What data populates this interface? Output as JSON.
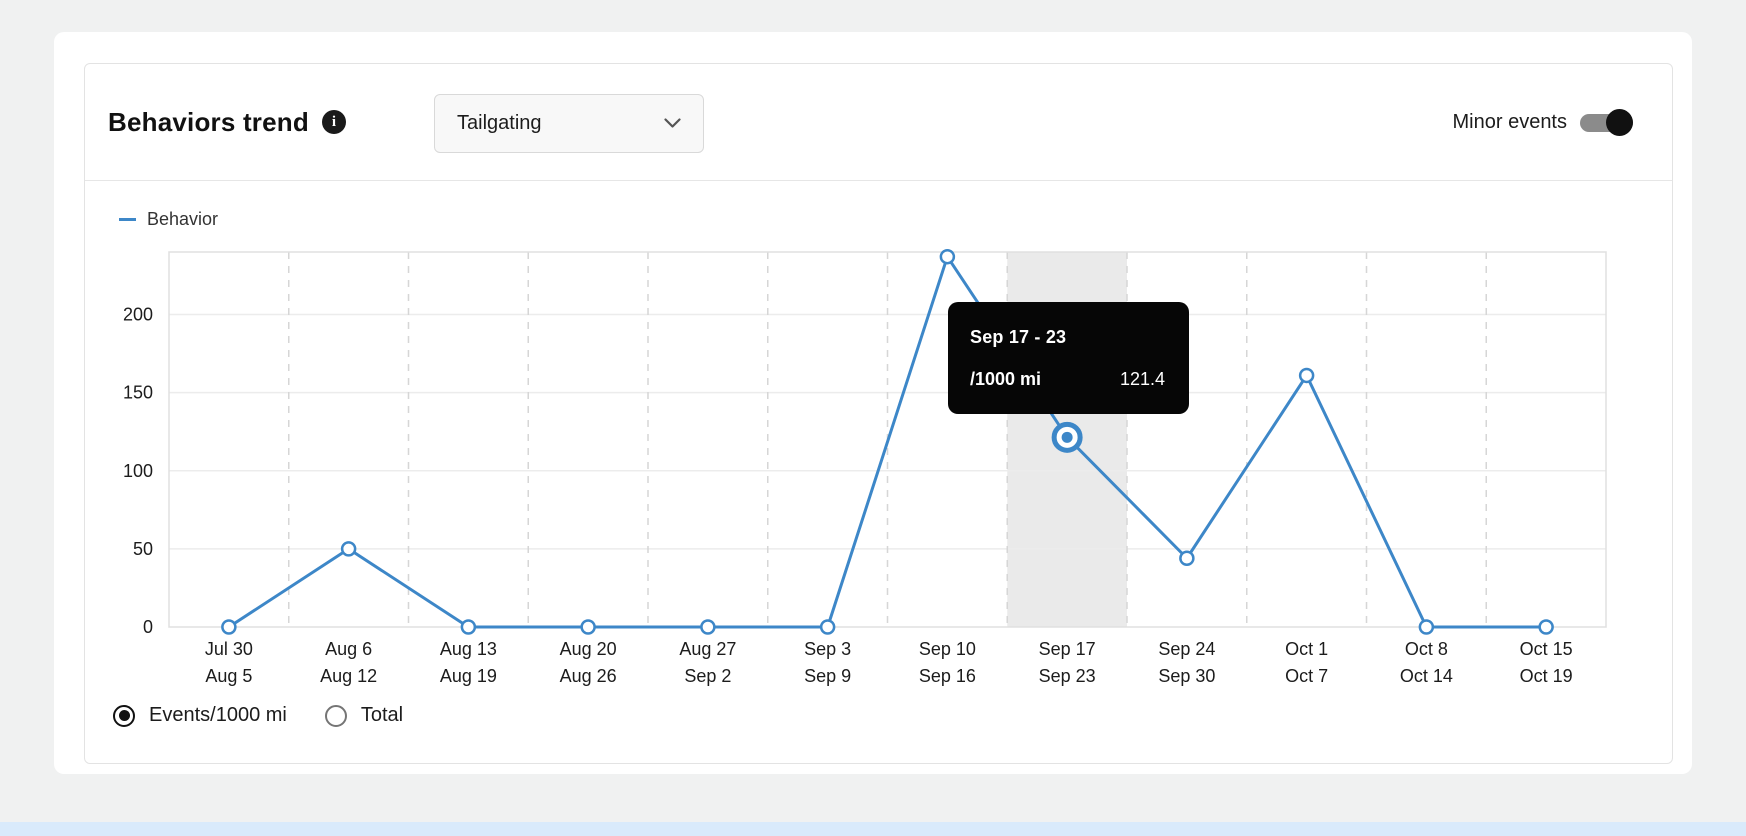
{
  "header": {
    "title": "Behaviors trend",
    "dropdown": {
      "value": "Tailgating"
    },
    "minor_events": {
      "label": "Minor events",
      "enabled": true
    }
  },
  "legend": {
    "items": [
      {
        "label": "Behavior",
        "color": "#3d87c8"
      }
    ]
  },
  "tooltip": {
    "title": "Sep 17 - 23",
    "label": "/1000 mi",
    "value": "121.4"
  },
  "controls": {
    "radios": [
      {
        "label": "Events/1000 mi",
        "selected": true
      },
      {
        "label": "Total",
        "selected": false
      }
    ]
  },
  "colors": {
    "accent_blue": "#3d87c8",
    "tooltip_bg": "#060606",
    "highlight_band": "#eaeaea",
    "grid_solid": "#ececec",
    "grid_dashed": "#d6d6d6",
    "plot_border": "#e0e0e0",
    "axis_text": "#1c1c1c",
    "bottom_strip": "#d9eafb"
  },
  "chart_data": {
    "type": "line",
    "title": "Behaviors trend",
    "xlabel": "",
    "ylabel": "",
    "categories": [
      [
        "Jul 30",
        "Aug 5"
      ],
      [
        "Aug 6",
        "Aug 12"
      ],
      [
        "Aug 13",
        "Aug 19"
      ],
      [
        "Aug 20",
        "Aug 26"
      ],
      [
        "Aug 27",
        "Sep 2"
      ],
      [
        "Sep 3",
        "Sep 9"
      ],
      [
        "Sep 10",
        "Sep 16"
      ],
      [
        "Sep 17",
        "Sep 23"
      ],
      [
        "Sep 24",
        "Sep 30"
      ],
      [
        "Oct 1",
        "Oct 7"
      ],
      [
        "Oct 8",
        "Oct 14"
      ],
      [
        "Oct 15",
        "Oct 19"
      ]
    ],
    "series": [
      {
        "name": "Behavior",
        "color": "#3d87c8",
        "values": [
          0,
          50,
          0,
          0,
          0,
          0,
          237,
          121.4,
          44,
          161,
          0,
          0
        ]
      }
    ],
    "yticks": [
      0,
      50,
      100,
      150,
      200
    ],
    "ylim": [
      0,
      240
    ],
    "highlighted_index": 7,
    "grid": {
      "horizontal": "solid",
      "vertical": "dashed-band-boundaries"
    },
    "legend_position": "top-left",
    "unit": "Events/1000 mi"
  }
}
